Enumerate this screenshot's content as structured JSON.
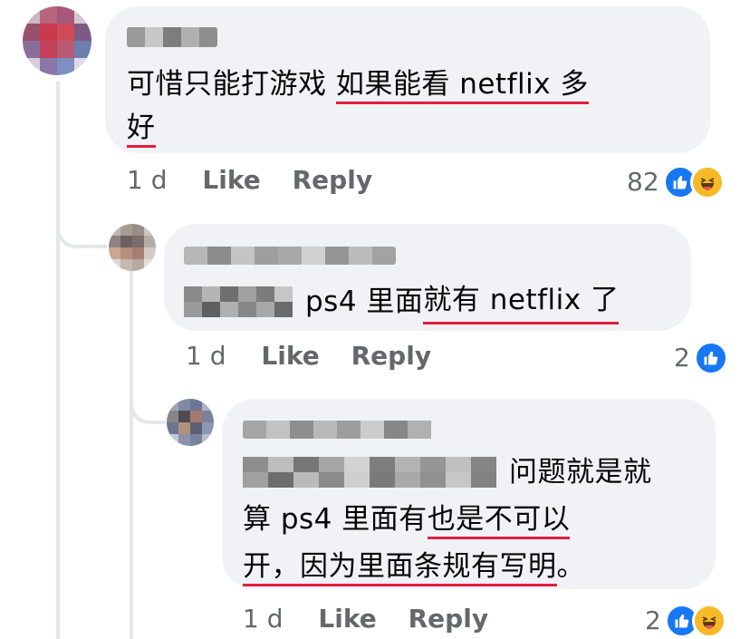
{
  "comments": [
    {
      "text_plain": "可惜只能打游戏 ",
      "text_underlined_1": "如果能看 netflix 多",
      "text_underlined_2": "好",
      "time": "1 d",
      "like": "Like",
      "reply": "Reply",
      "reaction_count": "82",
      "reactions": [
        "like-icon",
        "haha-icon"
      ]
    },
    {
      "text_plain": "ps4 里面",
      "text_underlined": "就有 netflix 了",
      "time": "1 d",
      "like": "Like",
      "reply": "Reply",
      "reaction_count": "2",
      "reactions": [
        "like-icon"
      ]
    },
    {
      "text_plain_1": "问题就是就",
      "text_plain_2": "算 ps4 里面有",
      "text_underlined_1": "也是不可以",
      "text_underlined_2": "开，因为里面条规有写明",
      "text_end": "。",
      "time": "1 d",
      "like": "Like",
      "reply": "Reply",
      "reaction_count": "2",
      "reactions": [
        "like-icon",
        "haha-icon"
      ]
    }
  ],
  "colors": {
    "bubble": "#f0f2f5",
    "underline": "#e41e3f",
    "like_blue": "#1877f2",
    "haha_yellow": "#f7b928",
    "meta_text": "#65676b"
  }
}
